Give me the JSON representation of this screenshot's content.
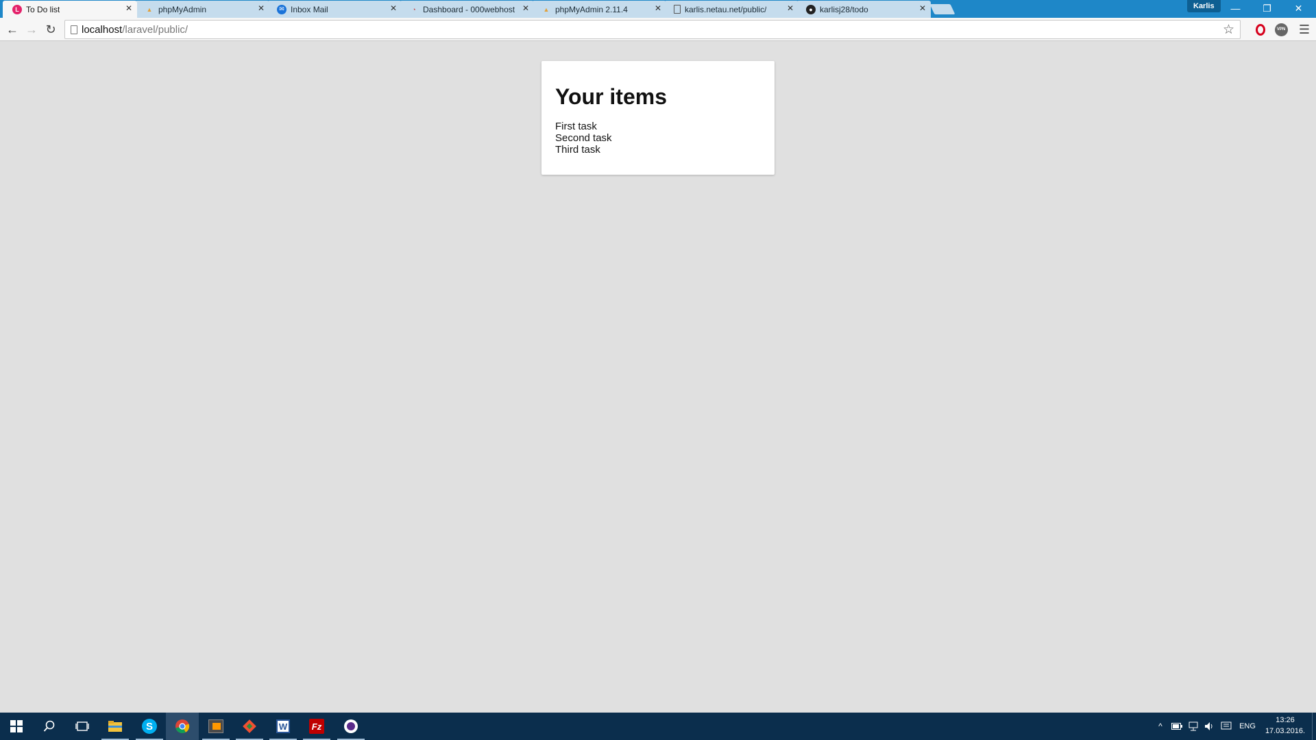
{
  "browser": {
    "tabs": [
      {
        "title": "To Do list",
        "favicon": "laravel-icon",
        "active": true
      },
      {
        "title": "phpMyAdmin",
        "favicon": "phpmyadmin-icon",
        "active": false
      },
      {
        "title": "Inbox Mail",
        "favicon": "mail-icon",
        "active": false
      },
      {
        "title": "Dashboard - 000webhost",
        "favicon": "webhost-icon",
        "active": false
      },
      {
        "title": "phpMyAdmin 2.11.4",
        "favicon": "phpmyadmin-icon",
        "active": false
      },
      {
        "title": "karlis.netau.net/public/",
        "favicon": "page-icon",
        "active": false
      },
      {
        "title": "karlisj28/todo",
        "favicon": "github-icon",
        "active": false
      }
    ],
    "profile_name": "Karlis",
    "url_host": "localhost",
    "url_path": "/laravel/public/",
    "accent_color": "#1e87c8"
  },
  "page": {
    "heading": "Your items",
    "items": [
      "First task",
      "Second task",
      "Third task"
    ],
    "background_color": "#e0e0e0"
  },
  "taskbar": {
    "apps": [
      "windows-start-icon",
      "search-icon",
      "task-view-icon",
      "file-explorer-icon",
      "skype-icon",
      "chrome-icon",
      "sublime-text-icon",
      "git-icon",
      "word-icon",
      "filezilla-icon",
      "app-icon"
    ],
    "language": "ENG",
    "time": "13:26",
    "date": "17.03.2016."
  }
}
